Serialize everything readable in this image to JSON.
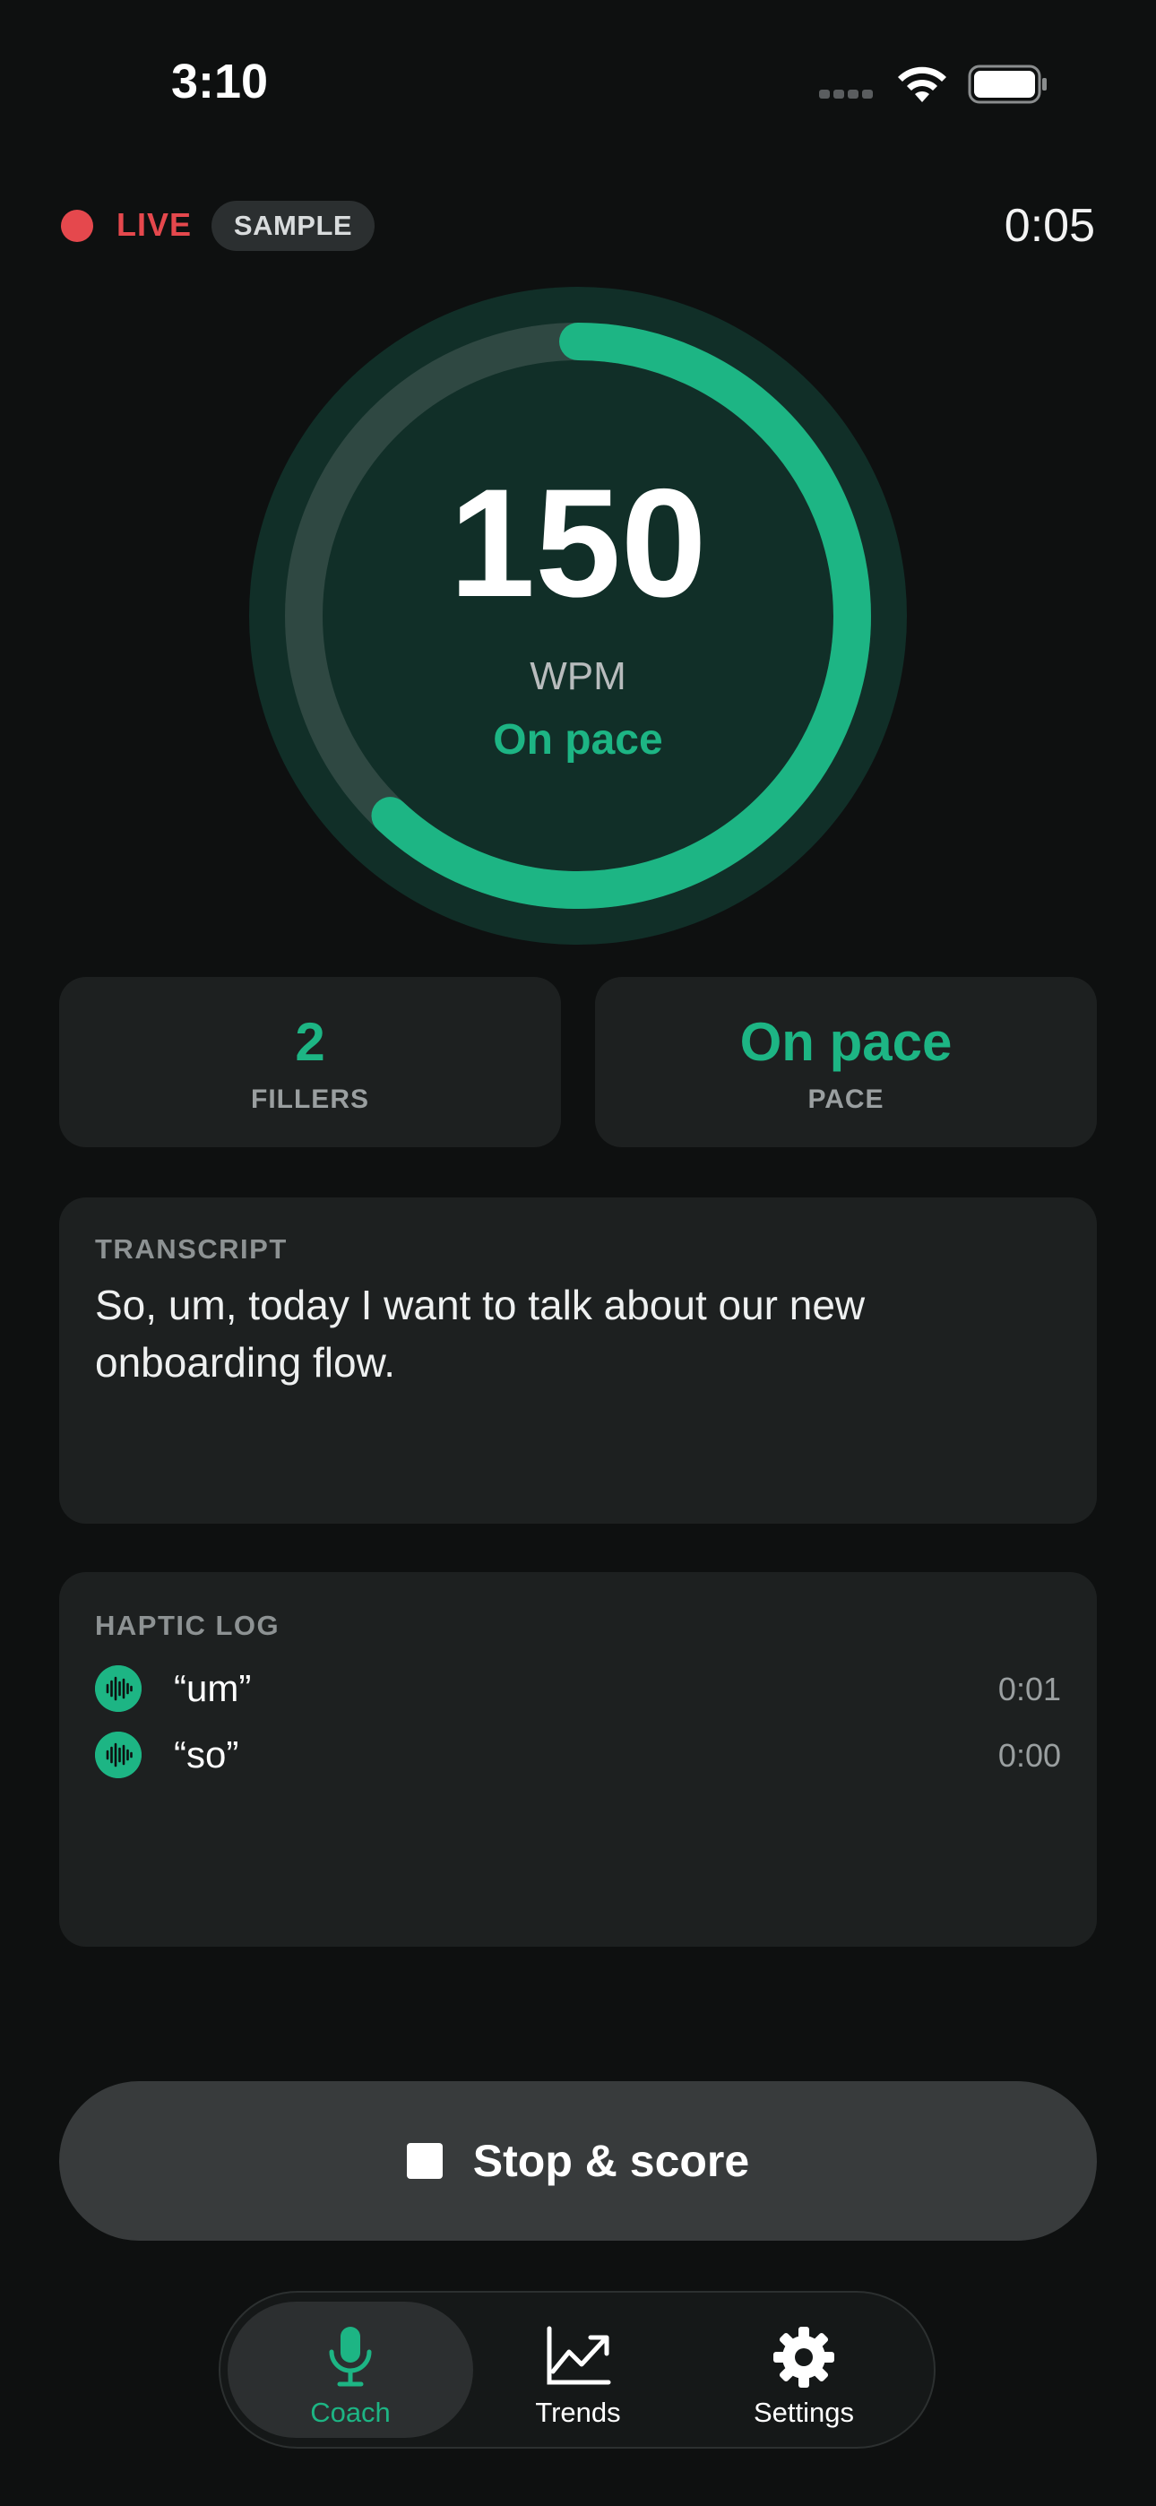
{
  "status_bar": {
    "time": "3:10"
  },
  "session": {
    "live_label": "LIVE",
    "sample_badge": "SAMPLE",
    "elapsed": "0:05",
    "gauge_fraction": 0.62
  },
  "gauge": {
    "value": "150",
    "unit": "WPM",
    "status": "On pace"
  },
  "stats": [
    {
      "value": "2",
      "label": "FILLERS"
    },
    {
      "value": "On pace",
      "label": "PACE"
    }
  ],
  "transcript": {
    "label": "TRANSCRIPT",
    "text": "So, um, today I want to talk about our new onboarding flow."
  },
  "haptic_log": {
    "label": "HAPTIC LOG",
    "entries": [
      {
        "word": "“um”",
        "time": "0:01"
      },
      {
        "word": "“so”",
        "time": "0:00"
      }
    ]
  },
  "actions": {
    "stop_label": "Stop & score"
  },
  "tabs": [
    {
      "label": "Coach",
      "icon": "microphone-icon",
      "active": true
    },
    {
      "label": "Trends",
      "icon": "chart-trend-icon",
      "active": false
    },
    {
      "label": "Settings",
      "icon": "gear-icon",
      "active": false
    }
  ],
  "colors": {
    "accent": "#1db584",
    "live": "#e5484d",
    "background": "#0e1010",
    "card": "#1d2020"
  }
}
